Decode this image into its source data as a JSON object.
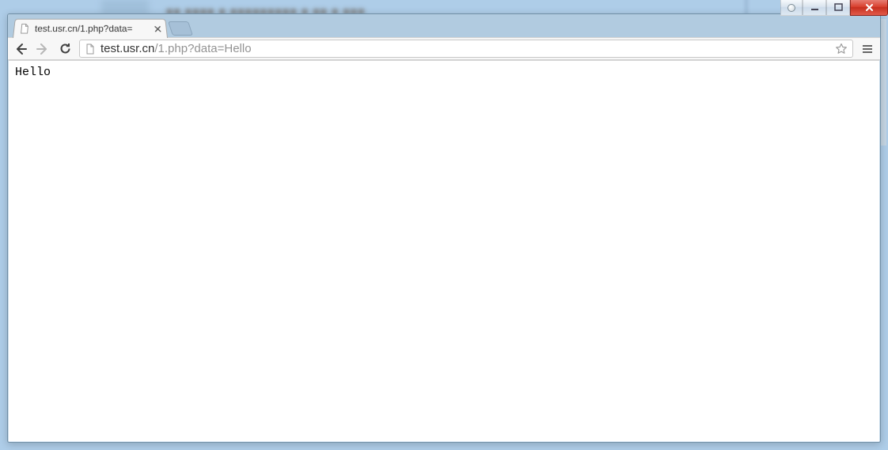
{
  "tab": {
    "title": "test.usr.cn/1.php?data="
  },
  "address_bar": {
    "host": "test.usr.cn",
    "path": "/1.php?data=Hello"
  },
  "page": {
    "body_text": "Hello"
  }
}
